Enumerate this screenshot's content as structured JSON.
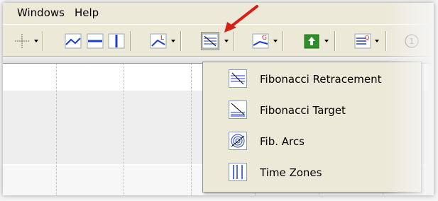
{
  "menubar": {
    "items": [
      "Windows",
      "Help"
    ]
  },
  "toolbar": {
    "buttons": [
      {
        "name": "crosshair-icon"
      },
      {
        "name": "trendline-icon"
      },
      {
        "name": "horizontal-line-icon"
      },
      {
        "name": "vertical-line-icon"
      },
      {
        "name": "angle-tool-icon"
      },
      {
        "name": "fibonacci-tools-icon"
      },
      {
        "name": "gann-tools-icon"
      },
      {
        "name": "arrow-up-icon"
      },
      {
        "name": "quote-list-icon"
      },
      {
        "name": "circle-number-icon",
        "text": "1"
      }
    ]
  },
  "dropdown": {
    "items": [
      {
        "label": "Fibonacci Retracement",
        "icon": "fibonacci-retracement-icon"
      },
      {
        "label": "Fibonacci Target",
        "icon": "fibonacci-target-icon"
      },
      {
        "label": "Fib. Arcs",
        "icon": "fib-arcs-icon"
      },
      {
        "label": "Time Zones",
        "icon": "time-zones-icon"
      }
    ]
  },
  "colors": {
    "annotation_arrow": "#d81f16",
    "tool_blue": "#1f3ec9",
    "menu_bg": "#ece9d8"
  }
}
